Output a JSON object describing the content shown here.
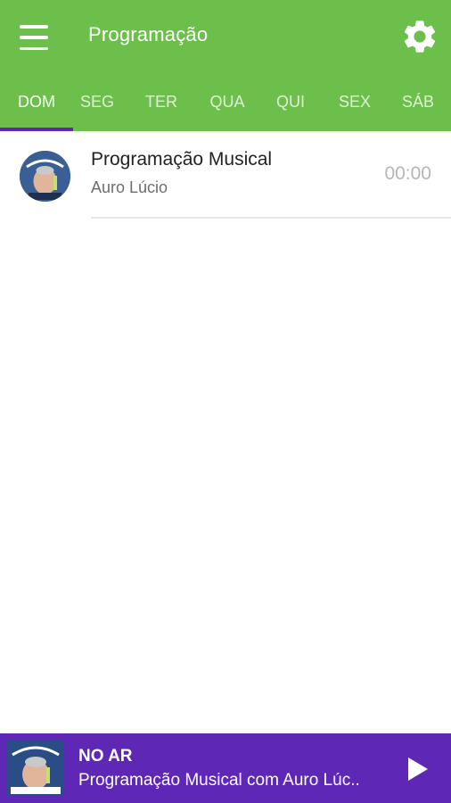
{
  "app_bar": {
    "title": "Programação",
    "menu_icon": "hamburger-menu-icon",
    "settings_icon": "gear-icon",
    "background": "#6cbf4a"
  },
  "tabs": [
    {
      "label": "DOM",
      "active": true
    },
    {
      "label": "SEG",
      "active": false
    },
    {
      "label": "TER",
      "active": false
    },
    {
      "label": "QUA",
      "active": false
    },
    {
      "label": "QUI",
      "active": false
    },
    {
      "label": "SEX",
      "active": false
    },
    {
      "label": "SÁB",
      "active": false
    }
  ],
  "tab_indicator_color": "#5e27b5",
  "schedule": [
    {
      "title": "Programação Musical",
      "host": "Auro Lúcio",
      "time": "00:00"
    }
  ],
  "player": {
    "label": "NO AR",
    "now_playing": "Programação Musical com Auro Lúc..",
    "play_icon": "play-icon",
    "background": "#5e27b5"
  }
}
